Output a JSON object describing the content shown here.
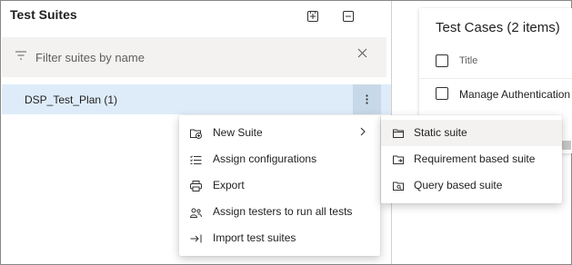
{
  "left_panel": {
    "title": "Test Suites",
    "expand_icon": "expand-all-icon",
    "collapse_icon": "collapse-all-icon",
    "filter": {
      "placeholder": "Filter suites by name",
      "value": ""
    },
    "suite": {
      "label": "DSP_Test_Plan (1)"
    }
  },
  "right_panel": {
    "title": "Test Cases (2 items)",
    "column_title": "Title",
    "rows": [
      {
        "title": "Manage Authentication"
      }
    ]
  },
  "context_menu": {
    "items": [
      {
        "label": "New Suite",
        "icon": "new-suite-icon",
        "has_submenu": true
      },
      {
        "label": "Assign configurations",
        "icon": "list-settings-icon"
      },
      {
        "label": "Export",
        "icon": "print-icon"
      },
      {
        "label": "Assign testers to run all tests",
        "icon": "people-icon"
      },
      {
        "label": "Import test suites",
        "icon": "import-icon"
      }
    ]
  },
  "submenu": {
    "items": [
      {
        "label": "Static suite",
        "icon": "folder-icon",
        "hovered": true
      },
      {
        "label": "Requirement based suite",
        "icon": "requirement-folder-icon"
      },
      {
        "label": "Query based suite",
        "icon": "query-folder-icon"
      }
    ]
  },
  "colors": {
    "selected_row": "#deecf9",
    "more_button": "#c7d9e8",
    "filter_bg": "#f3f2f1",
    "hover_bg": "#f3f2f1"
  }
}
